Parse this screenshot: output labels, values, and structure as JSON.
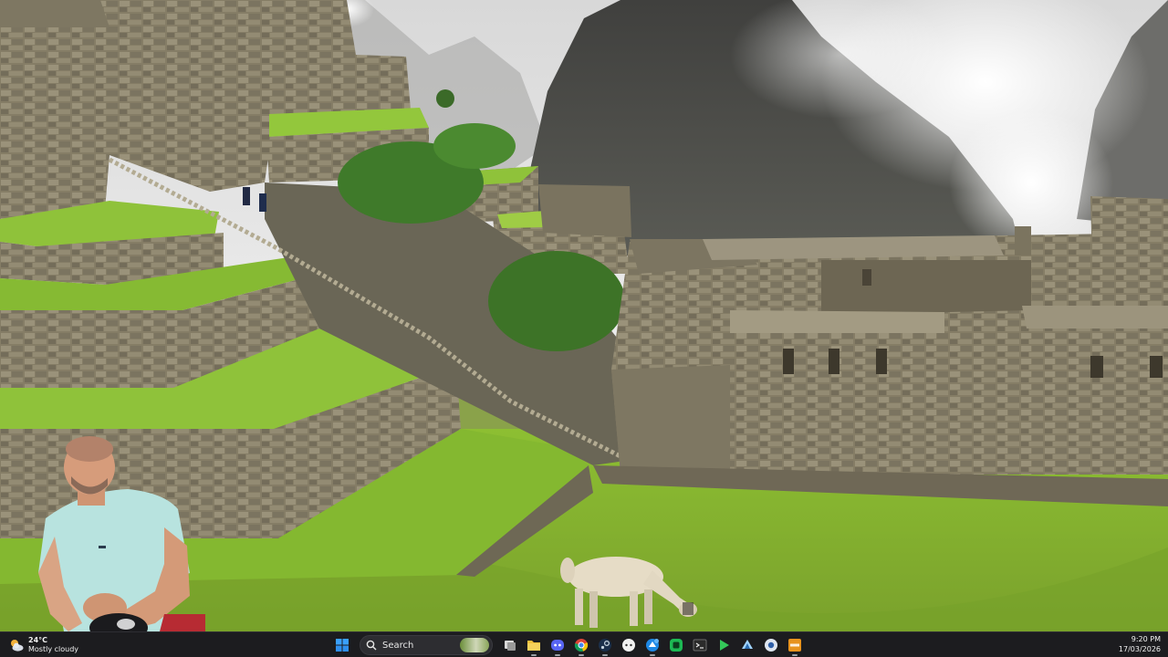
{
  "taskbar": {
    "weather": {
      "temp": "24°C",
      "condition": "Mostly cloudy",
      "icon": "partly-cloudy-icon"
    },
    "search": {
      "placeholder": "Search"
    },
    "pinned": [
      {
        "name": "start-button",
        "icon": "windows-logo-icon"
      },
      {
        "name": "task-view",
        "icon": "task-view-icon"
      },
      {
        "name": "file-explorer",
        "icon": "folder-icon"
      },
      {
        "name": "discord",
        "icon": "discord-icon"
      },
      {
        "name": "chrome",
        "icon": "chrome-icon"
      },
      {
        "name": "steam",
        "icon": "steam-icon"
      },
      {
        "name": "app-circle",
        "icon": "circle-app-icon"
      },
      {
        "name": "app-blue",
        "icon": "blue-app-icon"
      },
      {
        "name": "app-green",
        "icon": "green-app-icon"
      },
      {
        "name": "terminal",
        "icon": "terminal-icon"
      },
      {
        "name": "media-player",
        "icon": "play-icon"
      },
      {
        "name": "steam-2",
        "icon": "steam-icon"
      },
      {
        "name": "app-round",
        "icon": "round-app-icon"
      },
      {
        "name": "obs",
        "icon": "obs-orange-icon"
      }
    ],
    "clock": {
      "time": "9:20 PM",
      "date": "17/03/2026"
    }
  },
  "colors": {
    "taskbar_bg": "#1c1c1f",
    "accent_orange": "#e8931e",
    "grass": "#7fae2e"
  }
}
